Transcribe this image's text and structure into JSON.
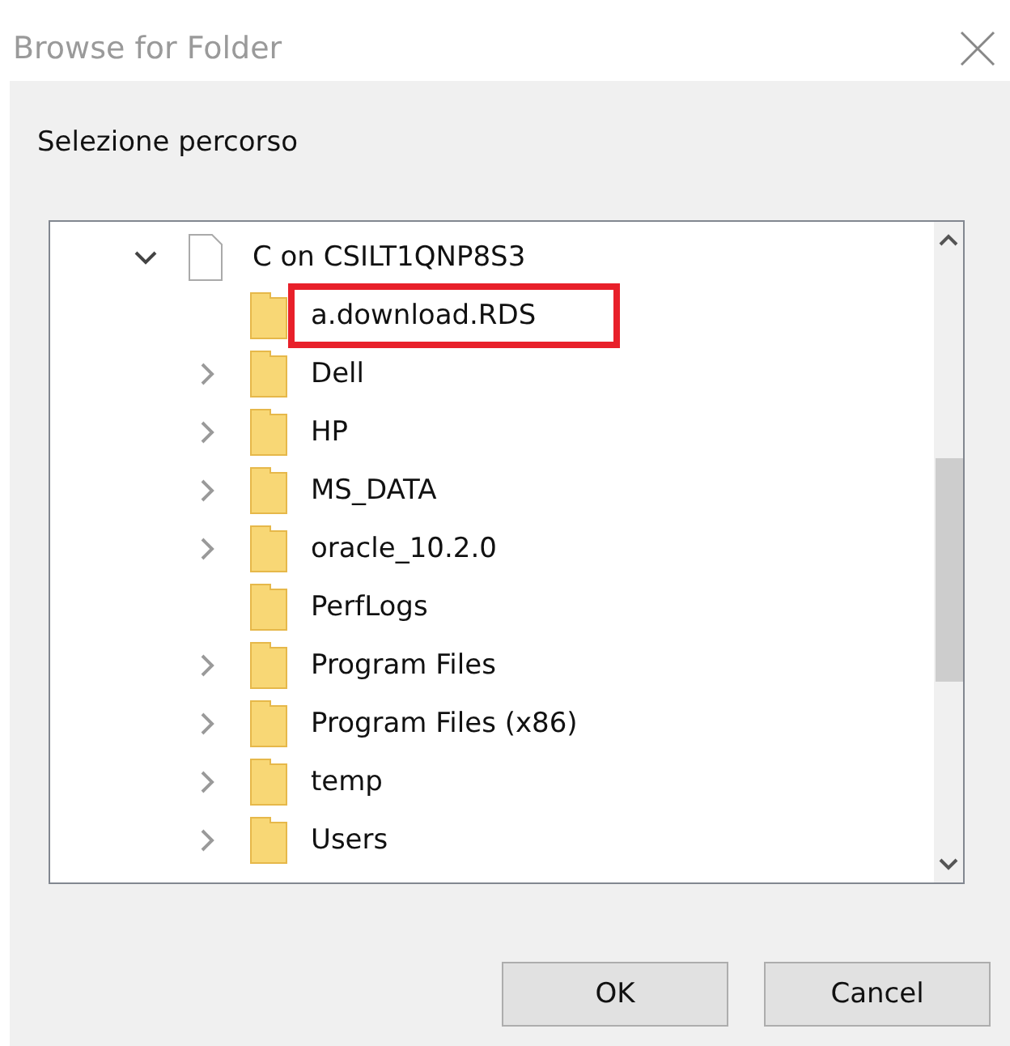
{
  "window": {
    "title": "Browse for Folder"
  },
  "label": "Selezione percorso",
  "tree": {
    "label": "C on CSILT1QNP8S3",
    "expanded": true,
    "children": [
      {
        "label": "a.download.RDS",
        "expandable": false,
        "highlighted": true
      },
      {
        "label": "Dell",
        "expandable": true,
        "highlighted": false
      },
      {
        "label": "HP",
        "expandable": true,
        "highlighted": false
      },
      {
        "label": "MS_DATA",
        "expandable": true,
        "highlighted": false
      },
      {
        "label": "oracle_10.2.0",
        "expandable": true,
        "highlighted": false
      },
      {
        "label": "PerfLogs",
        "expandable": false,
        "highlighted": false
      },
      {
        "label": "Program Files",
        "expandable": true,
        "highlighted": false
      },
      {
        "label": "Program Files (x86)",
        "expandable": true,
        "highlighted": false
      },
      {
        "label": "temp",
        "expandable": true,
        "highlighted": false
      },
      {
        "label": "Users",
        "expandable": true,
        "highlighted": false
      }
    ]
  },
  "buttons": [
    "OK",
    "Cancel"
  ]
}
